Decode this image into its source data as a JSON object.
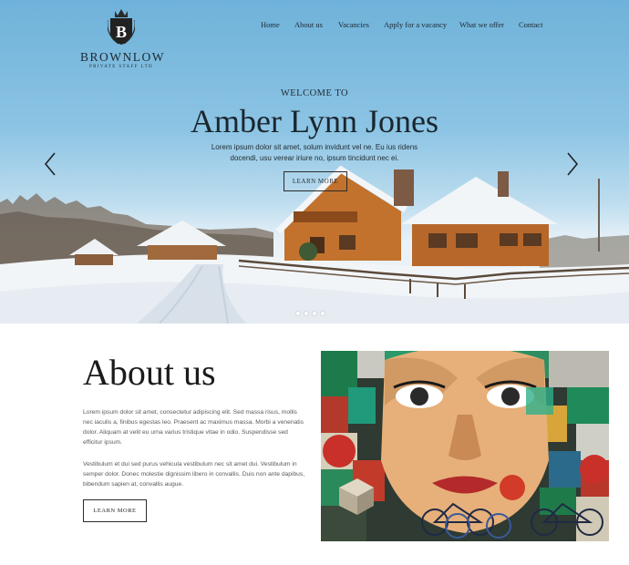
{
  "header": {
    "logo": {
      "brand": "BROWNLOW",
      "tagline": "PRIVATE STAFF LTD",
      "monogram": "B"
    },
    "nav": [
      {
        "label": "Home"
      },
      {
        "label": "About us"
      },
      {
        "label": "Vacancies"
      },
      {
        "label": "Apply for a vacancy"
      },
      {
        "label": "What we offer"
      },
      {
        "label": "Contact"
      }
    ]
  },
  "hero": {
    "kicker": "WELCOME TO",
    "title": "Amber Lynn Jones",
    "text": "Lorem ipsum dolor sit amet, solum invidunt vel ne. Eu ius ridens docendi, usu verear iriure no, ipsum tincidunt nec ei.",
    "button": "LEARN MORE",
    "slides": 4,
    "active_slide": 1
  },
  "about": {
    "title": "About us",
    "paragraph1": "Lorem ipsum dolor sit amet, consectetur adipiscing elit. Sed massa risus, mollis nec iaculis a, finibus egestas leo. Praesent ac maximus massa. Morbi a venenatis dolor. Aliquam at velit eu urna varius tristique vitae in odio. Suspendisse sed efficitur ipsum.",
    "paragraph2": "Vestibulum et dui sed purus vehicula vestibulum nec sit amet dui. Vestibulum in semper dolor. Donec molestie dignissim libero in convallis. Duis non ante dapibus, bibendum sapien at, convallis augue.",
    "button": "LEARN MORE"
  },
  "colors": {
    "sky": "#7fbde0",
    "text": "#1b262e",
    "body_text": "#5a5a5a"
  }
}
